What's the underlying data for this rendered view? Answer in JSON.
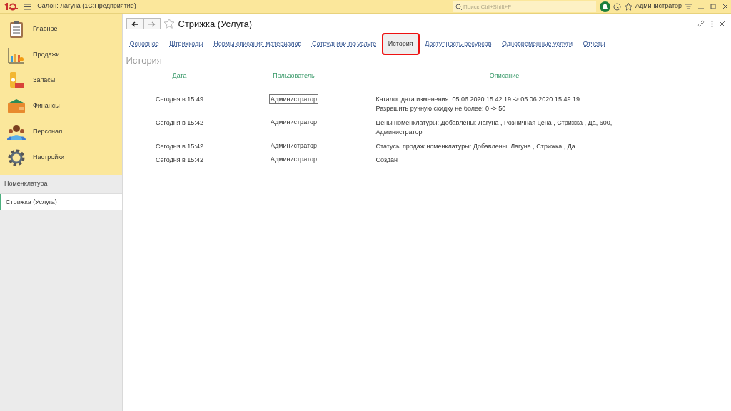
{
  "window": {
    "title": "Салон: Лагуна  (1С:Предприятие)",
    "search": {
      "placeholder": "Поиск Ctrl+Shift+F"
    },
    "user": "Администратор"
  },
  "sections": [
    {
      "label": "Главное",
      "kind": "clipboard"
    },
    {
      "label": "Продажи",
      "kind": "chart"
    },
    {
      "label": "Запасы",
      "kind": "stock"
    },
    {
      "label": "Финансы",
      "kind": "wallet"
    },
    {
      "label": "Персонал",
      "kind": "people"
    },
    {
      "label": "Настройки",
      "kind": "gear"
    }
  ],
  "open_windows": {
    "header": "Номенклатура",
    "items": [
      {
        "label": "Стрижка (Услуга)",
        "selected": true
      }
    ]
  },
  "form": {
    "title": "Стрижка (Услуга)",
    "favorite": false,
    "tabs": [
      {
        "label": "Основное",
        "selected": false
      },
      {
        "label": "Штрихкоды",
        "selected": false
      },
      {
        "label": "Нормы списания материалов",
        "selected": false
      },
      {
        "label": "Сотрудники по услуге",
        "selected": false
      },
      {
        "label": "История",
        "selected": true
      },
      {
        "label": "Доступность ресурсов",
        "selected": false
      },
      {
        "label": "Одновременные услуги",
        "selected": false
      },
      {
        "label": "Отчеты",
        "selected": false
      }
    ],
    "section_title": "История",
    "table": {
      "columns": [
        "Дата",
        "Пользователь",
        "Описание"
      ],
      "rows": [
        {
          "date": "Сегодня в 15:49",
          "user": "Администратор",
          "description": [
            "Каталог дата изменения: 05.06.2020 15:42:19 -> 05.06.2020 15:49:19",
            "Разрешить ручную скидку не более: 0 -> 50"
          ],
          "selected": true
        },
        {
          "date": "Сегодня в 15:42",
          "user": "Администратор",
          "description": [
            "Цены номенклатуры: Добавлены: Лагуна , Розничная цена , Стрижка , Да, 600, Администратор"
          ],
          "selected": false
        },
        {
          "date": "Сегодня в 15:42",
          "user": "Администратор",
          "description": [
            "Статусы продаж номенклатуры: Добавлены: Лагуна , Стрижка , Да"
          ],
          "selected": false
        },
        {
          "date": "Сегодня в 15:42",
          "user": "Администратор",
          "description": [
            "Создан"
          ],
          "selected": false
        }
      ]
    }
  }
}
